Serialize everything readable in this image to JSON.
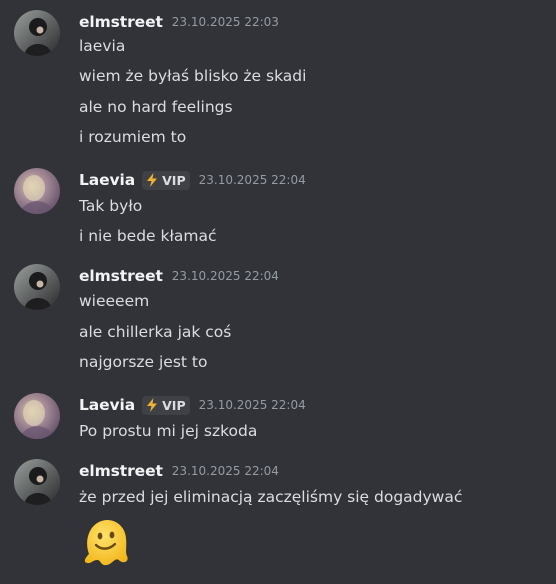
{
  "messages": [
    {
      "username": "elmstreet",
      "timestamp": "23.10.2025 22:03",
      "lines": [
        "laevia",
        "wiem że byłaś blisko że skadi",
        "ale no hard feelings",
        "i rozumiem to"
      ]
    },
    {
      "username": "Laevia",
      "badge": "VIP",
      "badge_icon": "lightning-icon",
      "timestamp": "23.10.2025 22:04",
      "lines": [
        "Tak było",
        "i nie bede kłamać"
      ]
    },
    {
      "username": "elmstreet",
      "timestamp": "23.10.2025 22:04",
      "lines": [
        "wieeeem",
        "ale chillerka jak coś",
        "najgorsze jest to"
      ]
    },
    {
      "username": "Laevia",
      "badge": "VIP",
      "badge_icon": "lightning-icon",
      "timestamp": "23.10.2025 22:04",
      "lines": [
        "Po prostu mi jej szkoda"
      ]
    },
    {
      "username": "elmstreet",
      "timestamp": "23.10.2025 22:04",
      "lines": [
        "że przed jej eliminacją zaczęliśmy się dogadywać"
      ],
      "emoji": "melting-face-emoji"
    }
  ],
  "colors": {
    "background": "#313338",
    "username": "#f2f3f5",
    "message_text": "#dbdee1",
    "timestamp": "#949ba4",
    "badge_bg": "#3f4147",
    "lightning": "#f0b232"
  }
}
